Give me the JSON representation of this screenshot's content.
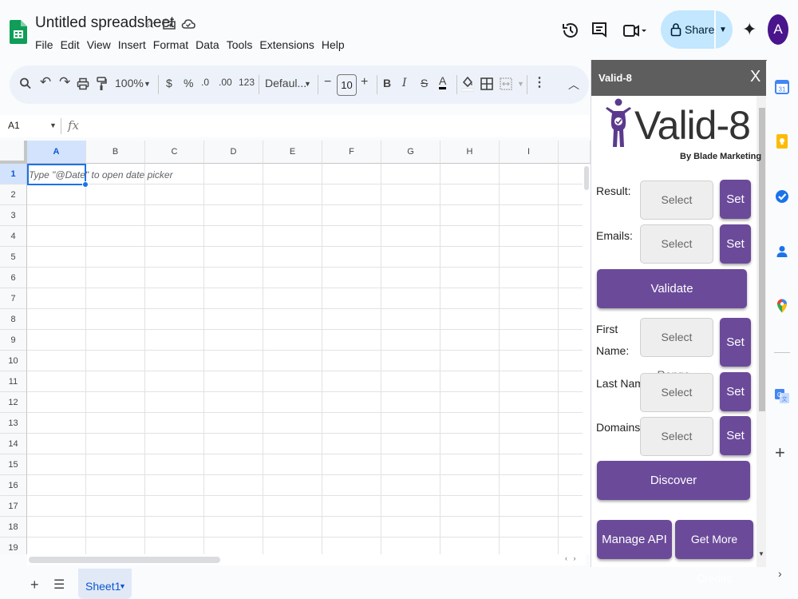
{
  "doc": {
    "title": "Untitled spreadsheet",
    "menus": [
      "File",
      "Edit",
      "View",
      "Insert",
      "Format",
      "Data",
      "Tools",
      "Extensions",
      "Help"
    ],
    "share_label": "Share",
    "avatar_initial": "A"
  },
  "toolbar": {
    "zoom": "100%",
    "currency": "$",
    "percent": "%",
    "decrease_decimals": ".0",
    "increase_decimals": ".00",
    "number_format": "123",
    "font": "Defaul...",
    "font_size": "10",
    "bold": "B",
    "italic": "I",
    "strikethrough": "S",
    "text_color": "A"
  },
  "formula_bar": {
    "name_box": "A1",
    "fx": "fx"
  },
  "grid": {
    "columns": [
      "A",
      "B",
      "C",
      "D",
      "E",
      "F",
      "G",
      "H",
      "I"
    ],
    "rows": [
      "1",
      "2",
      "3",
      "4",
      "5",
      "6",
      "7",
      "8",
      "9",
      "10",
      "11",
      "12",
      "13",
      "14",
      "15",
      "16",
      "17",
      "18",
      "19"
    ],
    "cell_hint": "Type \"@Date\" to open date picker"
  },
  "sheets": {
    "add": "+",
    "active_tab": "Sheet1"
  },
  "panel": {
    "title": "Valid-8",
    "close": "X",
    "logo_text": "Valid-8",
    "byline": "By Blade Marketing",
    "fields": [
      {
        "label": "Result:",
        "placeholder": "Select Range..",
        "button": "Set"
      },
      {
        "label": "Emails:",
        "placeholder": "Select Range..",
        "button": "Set"
      },
      {
        "label": "First Name:",
        "placeholder": "Select Range..",
        "button": "Set"
      },
      {
        "label": "Last Name:",
        "placeholder": "Select Range..",
        "button": "Set"
      },
      {
        "label": "Domains:",
        "placeholder": "Select Range..",
        "button": "Set"
      }
    ],
    "validate_label": "Validate",
    "discover_label": "Discover",
    "manage_api_label": "Manage API",
    "get_credits_label": "Get More Credits",
    "accent_color": "#6b4a9a"
  },
  "rail": {
    "icons": [
      "calendar-icon",
      "keep-icon",
      "tasks-icon",
      "contacts-icon",
      "maps-icon",
      "translate-icon"
    ]
  }
}
